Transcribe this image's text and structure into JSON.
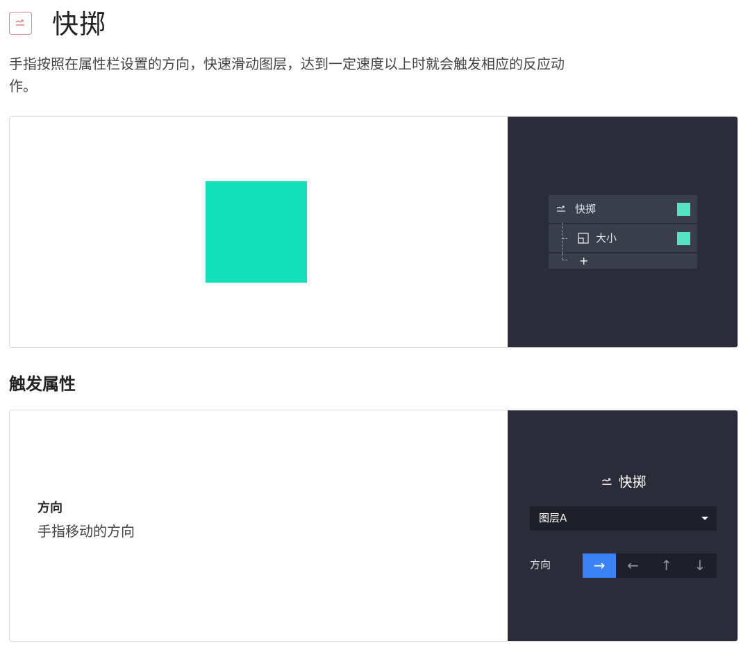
{
  "header": {
    "icon": "flick-icon",
    "title": "快掷",
    "description": "手指按照在属性栏设置的方向，快速滑动图层，达到一定速度以上时就会触发相应的反应动作。"
  },
  "demo": {
    "square_color": "#13dfbb",
    "tree": {
      "trigger_label": "快掷",
      "child_label": "大小",
      "add_label": "+",
      "swatch_color": "#54e3c3"
    }
  },
  "section": {
    "title": "触发属性"
  },
  "property": {
    "name": "方向",
    "description": "手指移动的方向"
  },
  "panel": {
    "title": "快掷",
    "select_value": "图层A",
    "direction_label": "方向",
    "directions": [
      "→",
      "←",
      "↑",
      "↓"
    ],
    "active_direction": "→",
    "accent_color": "#3b82f6"
  }
}
